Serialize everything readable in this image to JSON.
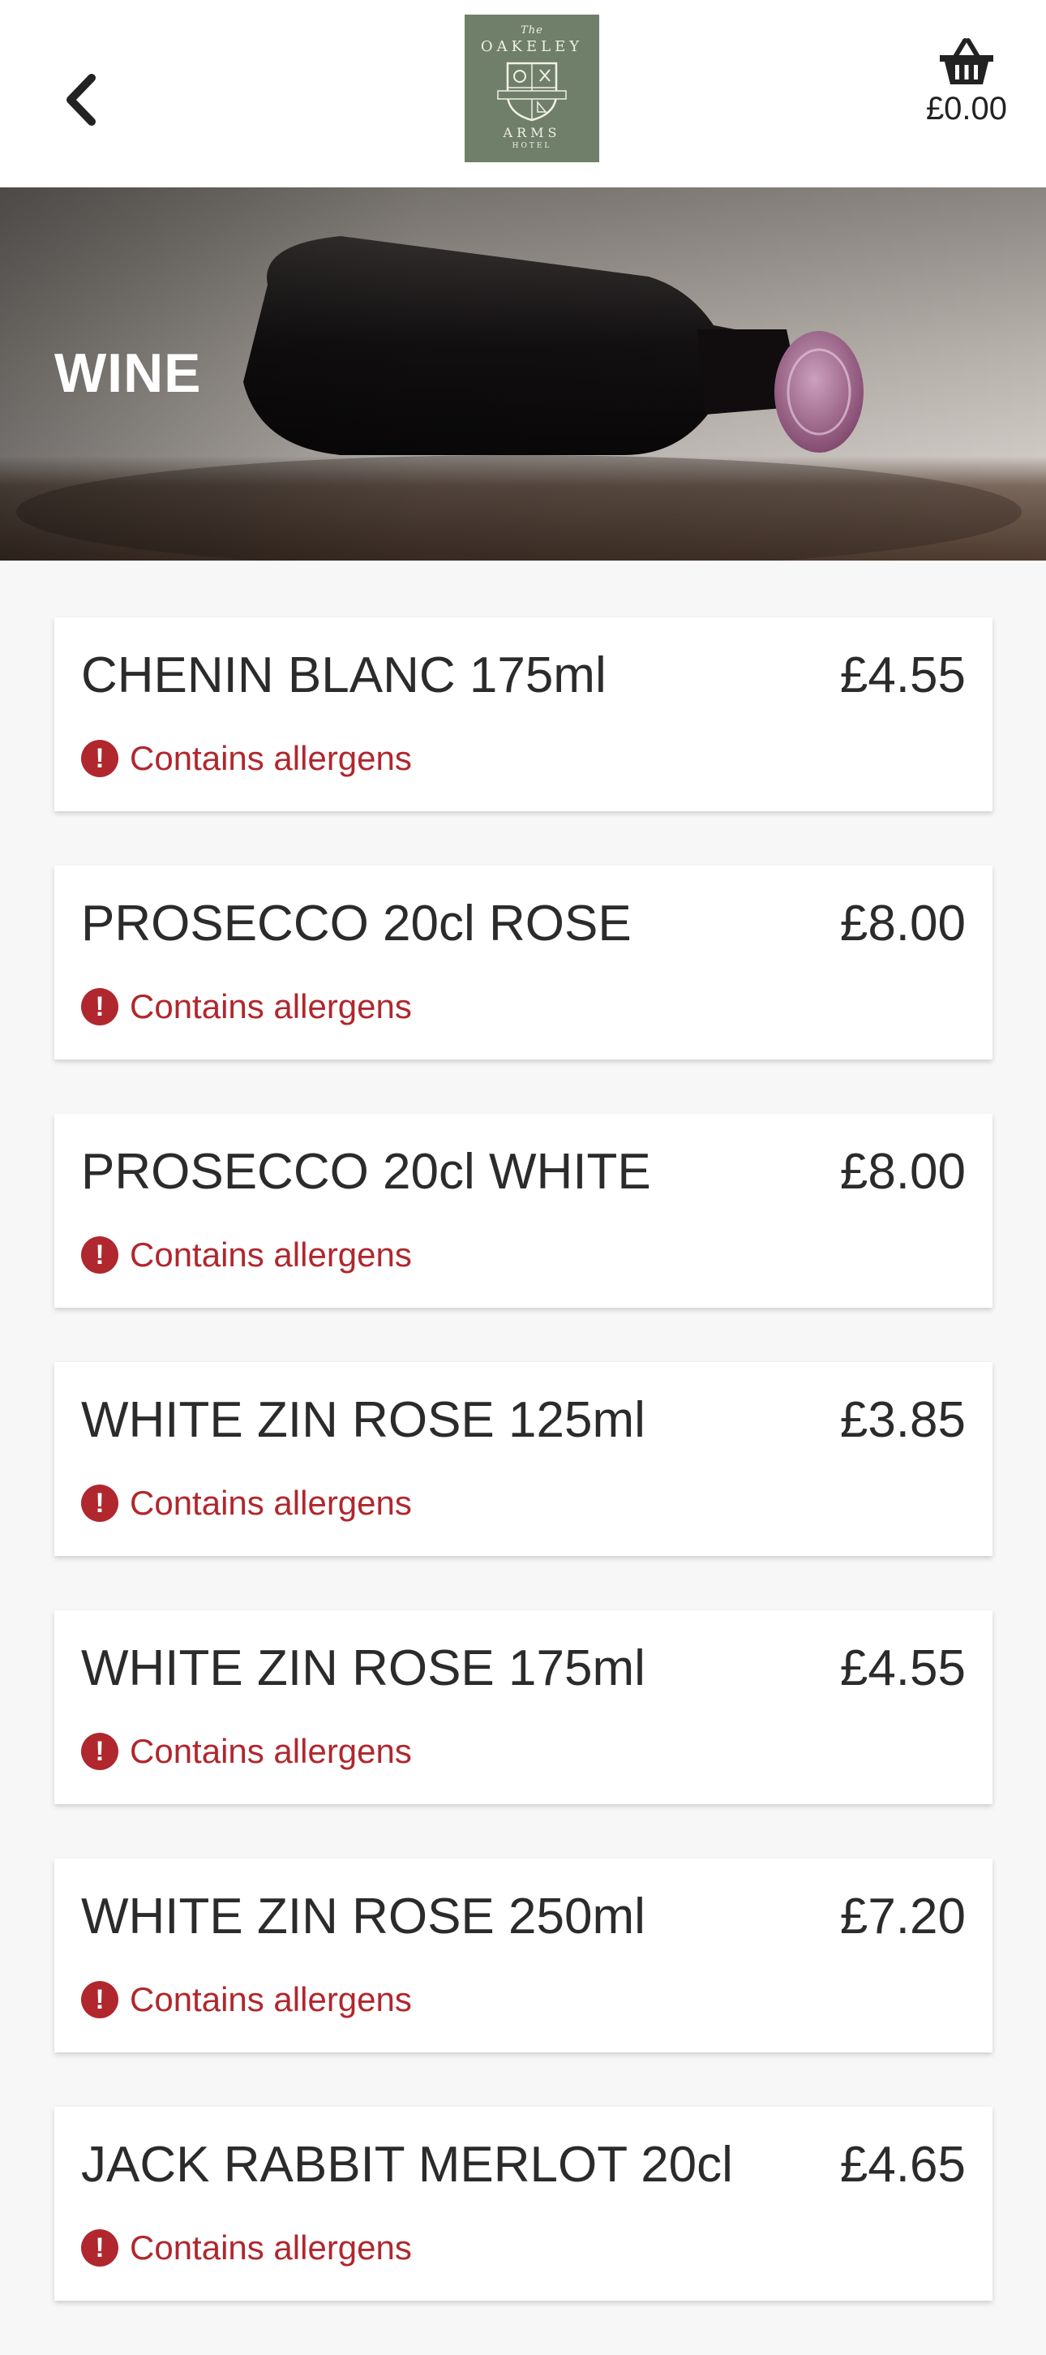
{
  "header": {
    "logo": {
      "line1": "The",
      "line2": "OAKELEY",
      "line3": "ARMS",
      "line4": "HOTEL"
    },
    "basket_total": "£0.00",
    "icons": {
      "back": "chevron-left-icon",
      "basket": "basket-icon"
    }
  },
  "hero": {
    "title": "WINE"
  },
  "colors": {
    "allergen": "#b0272d",
    "logo_bg": "#6f7f6a",
    "background": "#f7f7f7"
  },
  "items": [
    {
      "name": "CHENIN BLANC 175ml",
      "price": "£4.55",
      "allergen": "Contains allergens"
    },
    {
      "name": "PROSECCO 20cl ROSE",
      "price": "£8.00",
      "allergen": "Contains allergens"
    },
    {
      "name": "PROSECCO 20cl WHITE",
      "price": "£8.00",
      "allergen": "Contains allergens"
    },
    {
      "name": "WHITE ZIN ROSE 125ml",
      "price": "£3.85",
      "allergen": "Contains allergens"
    },
    {
      "name": "WHITE ZIN ROSE 175ml",
      "price": "£4.55",
      "allergen": "Contains allergens"
    },
    {
      "name": "WHITE ZIN ROSE 250ml",
      "price": "£7.20",
      "allergen": "Contains allergens"
    },
    {
      "name": "JACK RABBIT MERLOT 20cl",
      "price": "£4.65",
      "allergen": "Contains allergens"
    }
  ]
}
